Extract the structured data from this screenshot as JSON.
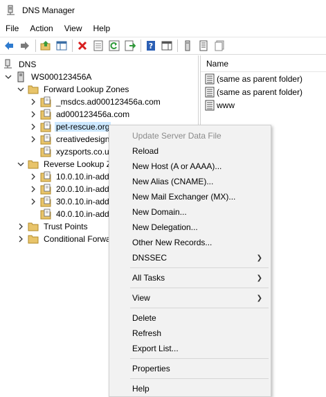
{
  "window": {
    "title": "DNS Manager"
  },
  "menubar": {
    "items": [
      "File",
      "Action",
      "View",
      "Help"
    ]
  },
  "toolbar": {
    "buttons": [
      "back-icon",
      "forward-icon",
      "up-folder-icon",
      "show-hide-tree-icon",
      "delete-icon",
      "properties-icon",
      "refresh-icon",
      "export-list-icon",
      "help-icon",
      "show-pane-icon",
      "server-icon",
      "zone-list-icon",
      "records-icon"
    ]
  },
  "tree": {
    "root": "DNS",
    "server": "WS000123456A",
    "forward_zones": "Forward Lookup Zones",
    "forward_children": [
      "_msdcs.ad000123456a.com",
      "ad000123456a.com",
      "pet-rescue.org",
      "creativedesign",
      "xyzsports.co.u"
    ],
    "reverse_zones": "Reverse Lookup Z",
    "reverse_children": [
      "10.0.10.in-add",
      "20.0.10.in-add",
      "30.0.10.in-add",
      "40.0.10.in-add"
    ],
    "trust_points": "Trust Points",
    "conditional": "Conditional Forwa"
  },
  "list": {
    "header": "Name",
    "rows": [
      "(same as parent folder)",
      "(same as parent folder)",
      "www"
    ]
  },
  "context_menu": {
    "update_server": "Update Server Data File",
    "reload": "Reload",
    "new_host": "New Host (A or AAAA)...",
    "new_alias": "New Alias (CNAME)...",
    "new_mx": "New Mail Exchanger (MX)...",
    "new_domain": "New Domain...",
    "new_delegation": "New Delegation...",
    "other_records": "Other New Records...",
    "dnssec": "DNSSEC",
    "all_tasks": "All Tasks",
    "view": "View",
    "delete": "Delete",
    "refresh": "Refresh",
    "export_list": "Export List...",
    "properties": "Properties",
    "help": "Help",
    "submenu_arrow": "❯"
  },
  "colors": {
    "selection": "#cce8ff",
    "folder": "#e8c46a",
    "menu_bg": "#f2f2f2"
  }
}
